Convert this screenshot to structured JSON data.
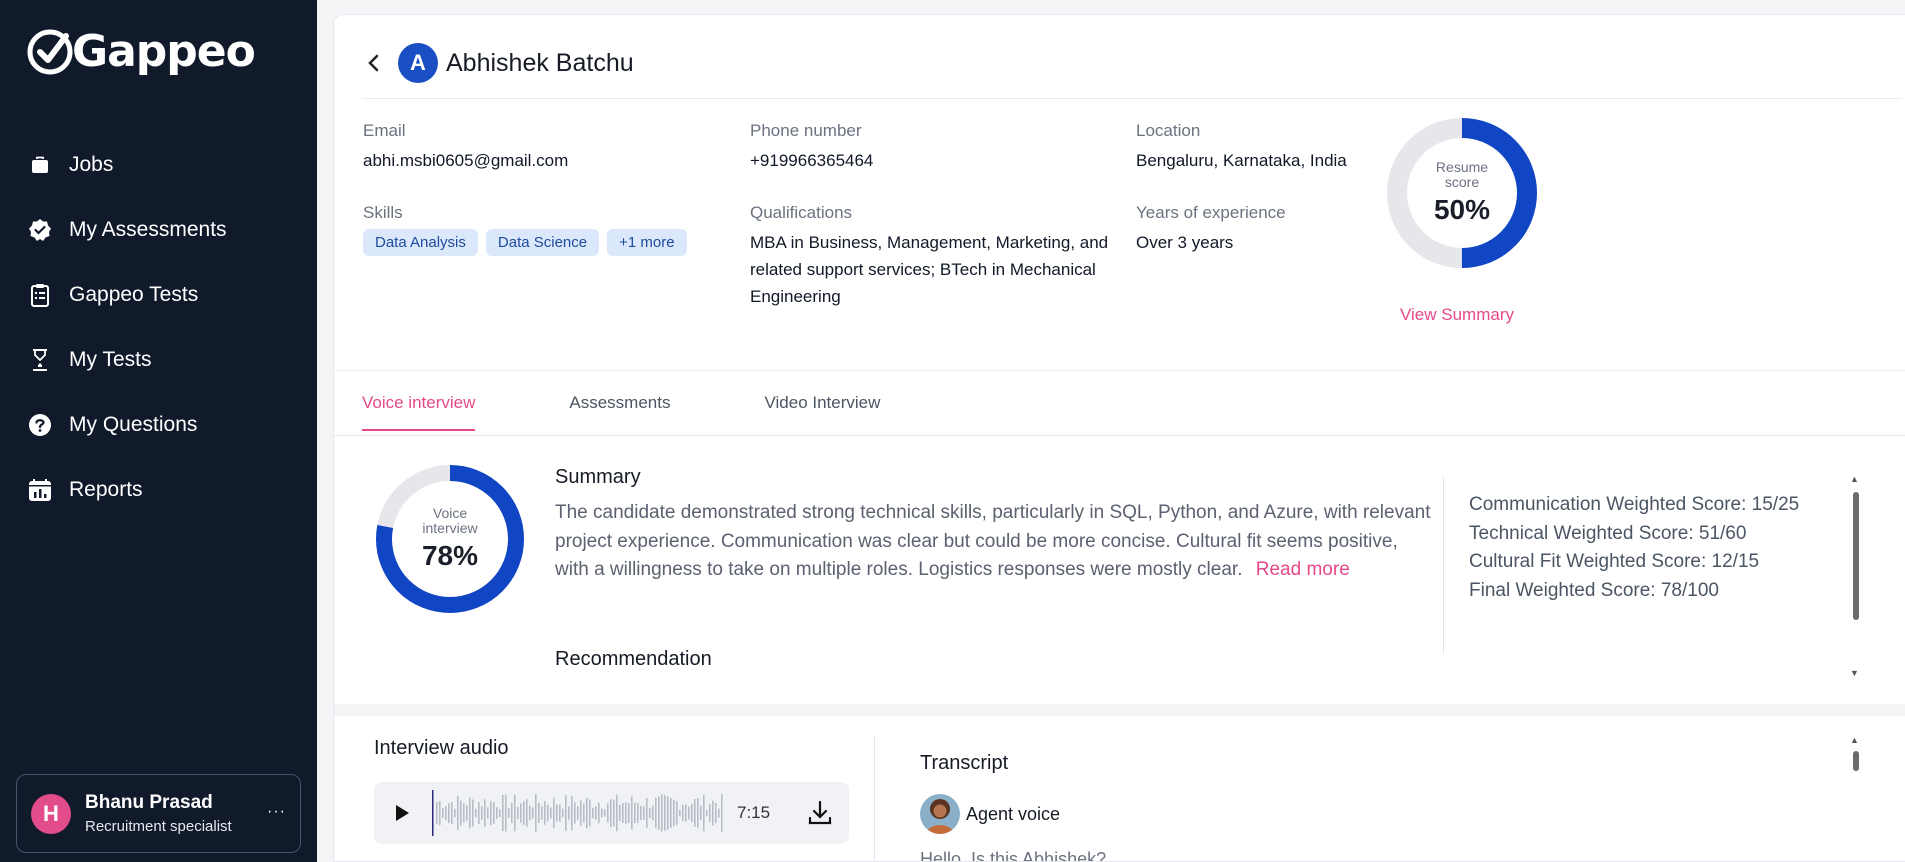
{
  "brand": {
    "name": "Gappeo"
  },
  "sidebar": {
    "items": [
      {
        "label": "Jobs",
        "icon": "briefcase-icon"
      },
      {
        "label": "My Assessments",
        "icon": "badge-check-icon"
      },
      {
        "label": "Gappeo Tests",
        "icon": "clipboard-icon"
      },
      {
        "label": "My Tests",
        "icon": "hourglass-icon"
      },
      {
        "label": "My Questions",
        "icon": "question-circle-icon"
      },
      {
        "label": "Reports",
        "icon": "calendar-report-icon"
      }
    ],
    "user": {
      "initial": "H",
      "name": "Bhanu Prasad",
      "role": "Recruitment specialist",
      "menu": "···"
    }
  },
  "candidate": {
    "initial": "A",
    "name": "Abhishek Batchu",
    "email_label": "Email",
    "email": "abhi.msbi0605@gmail.com",
    "phone_label": "Phone number",
    "phone": "+919966365464",
    "location_label": "Location",
    "location": "Bengaluru, Karnataka, India",
    "skills_label": "Skills",
    "skills": [
      "Data Analysis",
      "Data Science",
      "+1 more"
    ],
    "qualifications_label": "Qualifications",
    "qualifications": "MBA in Business, Management, Marketing, and related support services; BTech in Mechanical Engineering",
    "experience_label": "Years of experience",
    "experience": "Over 3 years",
    "resume_score": {
      "caption_line1": "Resume",
      "caption_line2": "score",
      "value_text": "50%",
      "value": 50
    },
    "view_summary": "View Summary"
  },
  "tabs": [
    {
      "label": "Voice interview",
      "active": true
    },
    {
      "label": "Assessments",
      "active": false
    },
    {
      "label": "Video Interview",
      "active": false
    }
  ],
  "voice_interview": {
    "score": {
      "caption_line1": "Voice",
      "caption_line2": "interview",
      "value_text": "78%",
      "value": 78
    },
    "summary_title": "Summary",
    "summary_text": "The candidate demonstrated strong technical skills, particularly in SQL, Python, and Azure, with relevant project experience. Communication was clear but could be more concise. Cultural fit seems positive, with a willingness to take on multiple roles. Logistics responses were mostly clear.",
    "read_more": "Read more",
    "recommendation_title": "Recommendation",
    "weighted_scores": [
      "Communication Weighted Score: 15/25",
      "Technical Weighted Score: 51/60",
      "Cultural Fit Weighted Score: 12/15",
      "Final Weighted Score: 78/100"
    ]
  },
  "audio": {
    "title": "Interview audio",
    "duration": "7:15"
  },
  "transcript": {
    "title": "Transcript",
    "agent_label": "Agent voice",
    "first_line": "Hello, Is this Abhishek?"
  },
  "colors": {
    "accent_pink": "#e5498a",
    "brand_blue": "#1a4fc4",
    "sidebar_bg": "#111a2b"
  }
}
